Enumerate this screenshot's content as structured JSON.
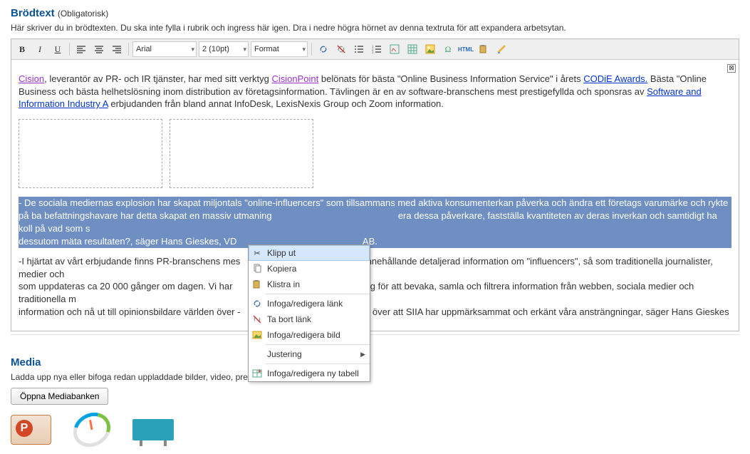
{
  "header": {
    "title": "Brödtext",
    "required": "(Obligatorisk)",
    "help": "Här skriver du in brödtexten. Du ska inte fylla i rubrik och ingress här igen. Dra i nedre högra hörnet av denna textruta för att expandera arbetsytan."
  },
  "toolbar": {
    "font_family": "Arial",
    "font_size": "2 (10pt)",
    "format": "Format"
  },
  "content": {
    "p1": {
      "link1": "Cision",
      "t1": ", leverantör av PR- och IR tjänster, har med sitt verktyg ",
      "link2": "CisionPoint",
      "t2": " belönats för bästa \"Online Business Information Service\" i årets ",
      "link3": "CODiE Awards.",
      "t3": " Bästa \"Online Business och bästa helhetslösning inom distribution av företagsinformation. Tävlingen är en av software-branschens mest prestigefyllda och sponsras av ",
      "link4": "Software and Information Industry A",
      "t4": " erbjudanden från bland annat InfoDesk, LexisNexis Group och Zoom information."
    },
    "selected_pre": "- De sociala mediernas explosion har skapat miljontals \"online-influencers\" som tillsammans med aktiva konsumenterkan påverka och ändra ett företags varumärke och rykte på ba befattningshavare har detta skapat en massiv utmaning",
    "selected_mid": "era dessa påverkare, fastställa kvantiteten av deras inverkan och samtidigt ha koll på vad som s",
    "selected_post": " dessutom mäta resultaten?, säger Hans Gieskes, VD",
    "selected_tail": "AB.",
    "p2_a": "-I hjärtat av vårt erbjudande finns PR-branschens mes",
    "p2_b": "nnehållande detaljerad information om \"influencers\", så som traditionella journalister, medier och",
    "p2_c": " som uppdateras ca 20 000 gånger om dagen. Vi har",
    "p2_d": "tyg för att bevaka, samla och filtrera information från webben, sociala medier och traditionella m",
    "p2_e": " information och nå ut till opinionsbildare världen över - ",
    "p2_f": "lada över att SIIA har uppmärksammat och erkänt våra ansträngningar, säger Hans Gieskes"
  },
  "context_menu": {
    "cut": "Klipp ut",
    "copy": "Kopiera",
    "paste": "Klistra in",
    "insert_link": "Infoga/redigera länk",
    "remove_link": "Ta bort länk",
    "insert_image": "Infoga/redigera bild",
    "justify": "Justering",
    "insert_table": "Infoga/redigera ny tabell"
  },
  "media": {
    "title": "Media",
    "help": "Ladda upp nya eller bifoga redan uppladdade bilder, video, presentationer och filer.",
    "open_button": "Öppna Mediabanken"
  }
}
